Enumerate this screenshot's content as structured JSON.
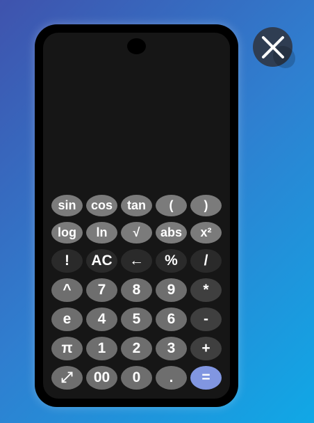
{
  "keys": {
    "sin": "sin",
    "cos": "cos",
    "tan": "tan",
    "lparen": "(",
    "rparen": ")",
    "log": "log",
    "ln": "ln",
    "sqrt": "√",
    "abs": "abs",
    "square": "x²",
    "factorial": "!",
    "ac": "AC",
    "backspace": "←",
    "percent": "%",
    "divide": "/",
    "power": "^",
    "n7": "7",
    "n8": "8",
    "n9": "9",
    "multiply": "*",
    "e": "e",
    "n4": "4",
    "n5": "5",
    "n6": "6",
    "minus": "-",
    "pi": "π",
    "n1": "1",
    "n2": "2",
    "n3": "3",
    "plus": "+",
    "expand": "⤢",
    "n00": "00",
    "n0": "0",
    "dot": ".",
    "equals": "="
  },
  "colors": {
    "accent_equals": "#8196e1",
    "phone_body": "#000000",
    "screen": "#161616"
  },
  "icons": {
    "close": "close-icon",
    "expand": "expand-icon"
  }
}
